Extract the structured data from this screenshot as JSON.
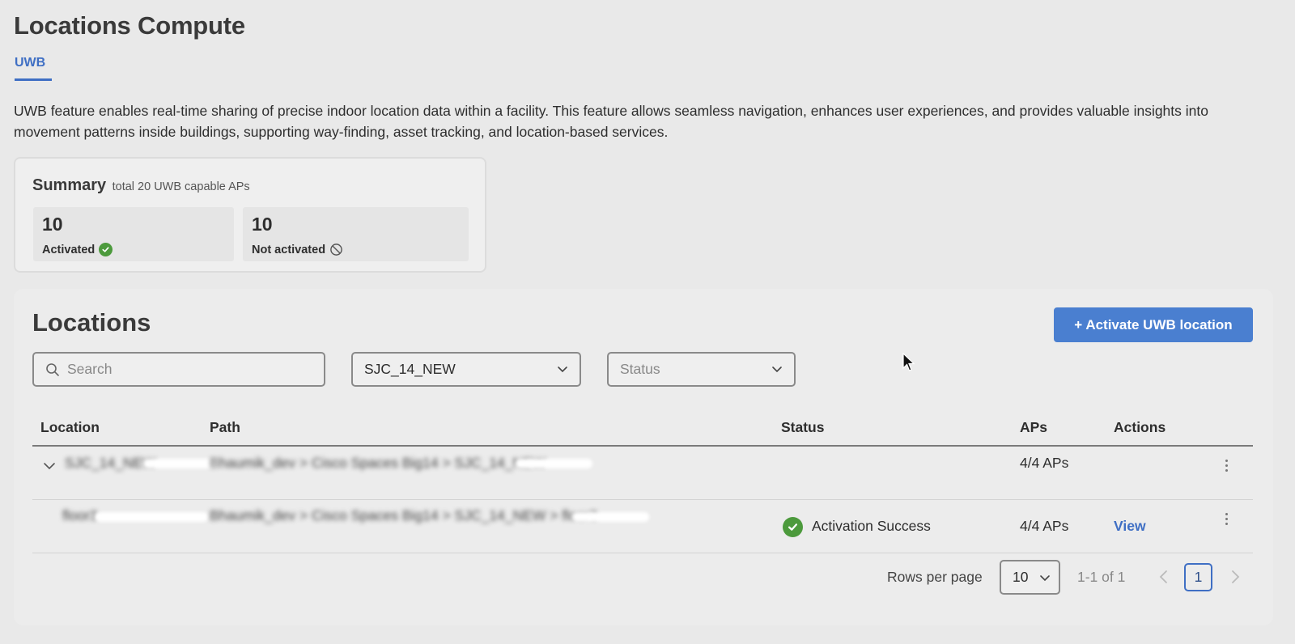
{
  "page": {
    "title": "Locations Compute",
    "tab_label": "UWB",
    "description": "UWB feature enables real-time sharing of precise indoor location data within a facility. This feature allows seamless navigation, enhances user experiences, and provides valuable insights into movement patterns inside buildings, supporting way-finding, asset tracking, and location-based services."
  },
  "summary": {
    "title": "Summary",
    "subtitle": "total 20 UWB capable APs",
    "activated": {
      "value": "10",
      "label": "Activated",
      "icon": "check-circle-icon"
    },
    "not_activated": {
      "value": "10",
      "label": "Not activated",
      "icon": "prohibited-icon"
    }
  },
  "locations": {
    "title": "Locations",
    "activate_button": "+ Activate UWB location",
    "search": {
      "placeholder": "Search",
      "value": ""
    },
    "location_filter": {
      "value": "SJC_14_NEW"
    },
    "status_filter": {
      "placeholder": "Status"
    },
    "columns": [
      "Location",
      "Path",
      "Status",
      "APs",
      "Actions"
    ],
    "rows": [
      {
        "location": "SJC_14_NEW",
        "path": "Bhaumik_dev > Cisco Spaces Big14 > SJC_14_NEW",
        "status": "",
        "aps": "4/4 APs",
        "action": ""
      },
      {
        "location": "floor3",
        "path": "Bhaumik_dev > Cisco Spaces Big14 > SJC_14_NEW > floor3",
        "status": "Activation Success",
        "aps": "4/4 APs",
        "action": "View"
      }
    ],
    "pagination": {
      "rows_per_page_label": "Rows per page",
      "rows_per_page": "10",
      "range": "1-1 of 1",
      "current_page": "1"
    }
  },
  "colors": {
    "accent": "#3f6fc4",
    "button": "#4a7fd0",
    "success": "#4c9a3c",
    "background": "#e9e9e9"
  }
}
